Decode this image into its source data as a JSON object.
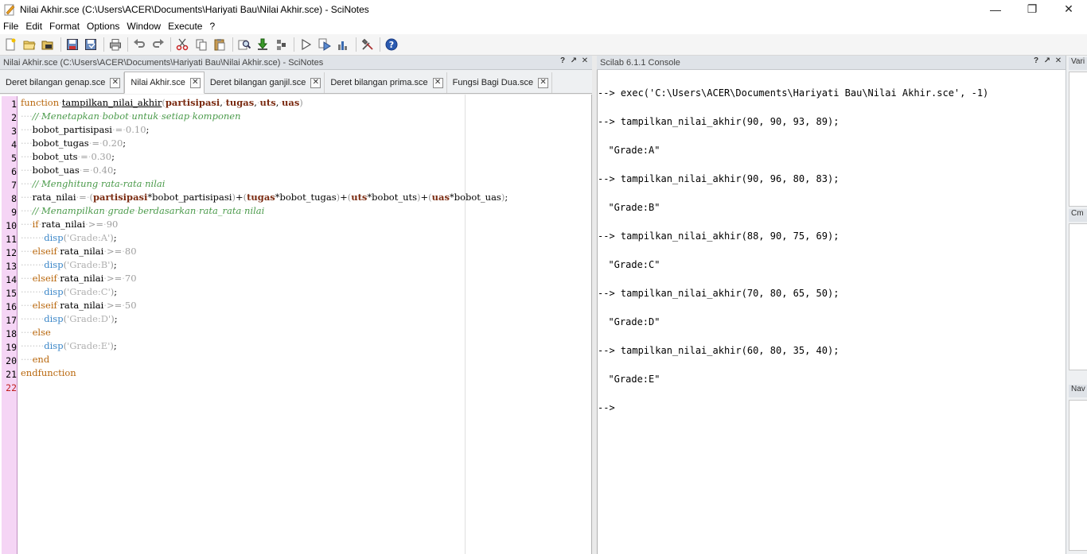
{
  "window": {
    "title": "Nilai Akhir.sce (C:\\Users\\ACER\\Documents\\Hariyati Bau\\Nilai Akhir.sce) - SciNotes",
    "minimize": "—",
    "maximize": "❐",
    "close": "✕"
  },
  "menu": [
    "File",
    "Edit",
    "Format",
    "Options",
    "Window",
    "Execute",
    "?"
  ],
  "toolbar": [
    "new-file-icon",
    "open-file-icon",
    "open-folder-icon",
    "save-icon",
    "save-as-icon",
    "print-icon",
    "undo-icon",
    "redo-icon",
    "cut-icon",
    "copy-icon",
    "paste-icon",
    "find-icon",
    "load-into-scilab-icon",
    "execute-icon",
    "run-icon",
    "run-file-icon",
    "profile-icon",
    "tools-icon",
    "help-icon"
  ],
  "editor": {
    "panel_title": "Nilai Akhir.sce (C:\\Users\\ACER\\Documents\\Hariyati Bau\\Nilai Akhir.sce) - SciNotes",
    "tabs": [
      {
        "label": "Deret bilangan genap.sce",
        "active": false
      },
      {
        "label": "Nilai Akhir.sce",
        "active": true
      },
      {
        "label": "Deret bilangan ganjil.sce",
        "active": false
      },
      {
        "label": "Deret bilangan prima.sce",
        "active": false
      },
      {
        "label": "Fungsi Bagi Dua.sce",
        "active": false
      }
    ],
    "line_numbers": [
      "1",
      "2",
      "3",
      "4",
      "5",
      "6",
      "7",
      "8",
      "9",
      "10",
      "11",
      "12",
      "13",
      "14",
      "15",
      "16",
      "17",
      "18",
      "19",
      "20",
      "21",
      "22"
    ],
    "code": [
      "function tampilkan_nilai_akhir(partisipasi, tugas, uts, uas)",
      "    // Menetapkan bobot untuk setiap komponen",
      "    bobot_partisipasi = 0.10;",
      "    bobot_tugas = 0.20;",
      "    bobot_uts = 0.30;",
      "    bobot_uas = 0.40;",
      "    // Menghitung rata-rata nilai",
      "    rata_nilai = (partisipasi*bobot_partisipasi)+(tugas*bobot_tugas)+(uts*bobot_uts)+(uas*bobot_uas);",
      "    // Menampilkan grade berdasarkan rata_rata nilai",
      "    if rata_nilai >= 90",
      "        disp('Grade:A');",
      "    elseif rata_nilai >= 80",
      "        disp('Grade:B');",
      "    elseif rata_nilai >= 70",
      "        disp('Grade:C');",
      "    elseif rata_nilai >= 50",
      "        disp('Grade:D');",
      "    else",
      "        disp('Grade:E');",
      "    end",
      "endfunction",
      ""
    ]
  },
  "console": {
    "panel_title": "Scilab 6.1.1 Console",
    "lines": [
      "--> exec('C:\\Users\\ACER\\Documents\\Hariyati Bau\\Nilai Akhir.sce', -1)",
      "--> tampilkan_nilai_akhir(90, 90, 93, 89);",
      "  \"Grade:A\"",
      "--> tampilkan_nilai_akhir(90, 96, 80, 83);",
      "  \"Grade:B\"",
      "--> tampilkan_nilai_akhir(88, 90, 75, 69);",
      "  \"Grade:C\"",
      "--> tampilkan_nilai_akhir(70, 80, 65, 50);",
      "  \"Grade:D\"",
      "--> tampilkan_nilai_akhir(60, 80, 35, 40);",
      "  \"Grade:E\"",
      "-->"
    ]
  },
  "side_panels": [
    "Vari",
    "Cm",
    "Nav"
  ],
  "panel_controls": [
    "?",
    "↗",
    "✕"
  ],
  "colors": {
    "gutter": "#f5d5f5",
    "keyword": "#b8660b",
    "comment": "#4a9a4a",
    "argument": "#7a2a10"
  }
}
